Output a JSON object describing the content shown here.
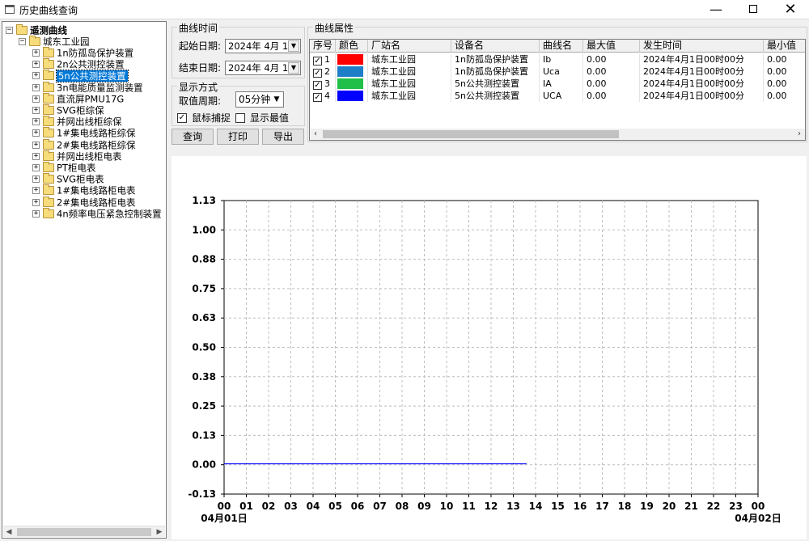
{
  "window": {
    "title": "历史曲线查询",
    "buttons": {
      "minimize": "—",
      "maximize": "",
      "close": "✕"
    }
  },
  "tree": {
    "root": "遥测曲线",
    "station": "城东工业园",
    "items": [
      "1n防孤岛保护装置",
      "2n公共测控装置",
      "5n公共测控装置",
      "3n电能质量监测装置",
      "直流屏PMU17G",
      "SVG柜综保",
      "并网出线柜综保",
      "1#集电线路柜综保",
      "2#集电线路柜综保",
      "并网出线柜电表",
      "PT柜电表",
      "SVG柜电表",
      "1#集电线路柜电表",
      "2#集电线路柜电表",
      "4n频率电压紧急控制装置"
    ],
    "selected_index": 2,
    "expand_symbols": {
      "expanded": "−",
      "collapsed": "+"
    }
  },
  "time_group": {
    "title": "曲线时间",
    "start_label": "起始日期:",
    "start_value": "2024年 4月 1",
    "end_label": "结束日期:",
    "end_value": "2024年 4月 1"
  },
  "display_group": {
    "title": "显示方式",
    "period_label": "取值周期:",
    "period_value": "05分钟",
    "mouse_capture_label": "鼠标捕捉",
    "mouse_capture_checked": true,
    "show_extremes_label": "显示最值",
    "show_extremes_checked": false
  },
  "actions": {
    "query": "查询",
    "print": "打印",
    "export": "导出"
  },
  "curve_props": {
    "title": "曲线属性",
    "columns": [
      "序号",
      "颜色",
      "厂站名",
      "设备名",
      "曲线名",
      "最大值",
      "发生时间",
      "最小值"
    ],
    "rows": [
      {
        "idx": "1",
        "checked": true,
        "color": "#ff0000",
        "station": "城东工业园",
        "device": "1n防孤岛保护装置",
        "curve": "Ib",
        "max": "0.00",
        "time": "2024年4月1日00时00分",
        "min": "0.00"
      },
      {
        "idx": "2",
        "checked": true,
        "color": "#1e7fc8",
        "station": "城东工业园",
        "device": "1n防孤岛保护装置",
        "curve": "Uca",
        "max": "0.00",
        "time": "2024年4月1日00时00分",
        "min": "0.00"
      },
      {
        "idx": "3",
        "checked": true,
        "color": "#1fbf4a",
        "station": "城东工业园",
        "device": "5n公共测控装置",
        "curve": "IA",
        "max": "0.00",
        "time": "2024年4月1日00时00分",
        "min": "0.00"
      },
      {
        "idx": "4",
        "checked": true,
        "color": "#0000ff",
        "station": "城东工业园",
        "device": "5n公共测控装置",
        "curve": "UCA",
        "max": "0.00",
        "time": "2024年4月1日00时00分",
        "min": "0.00"
      }
    ]
  },
  "chart_data": {
    "type": "line",
    "y_ticks": [
      "1.13",
      "1.00",
      "0.88",
      "0.75",
      "0.63",
      "0.50",
      "0.38",
      "0.25",
      "0.13",
      "0.00",
      "-0.13"
    ],
    "ylim": [
      -0.13,
      1.13
    ],
    "x_ticks": [
      "00",
      "01",
      "02",
      "03",
      "04",
      "05",
      "06",
      "07",
      "08",
      "09",
      "10",
      "11",
      "12",
      "13",
      "14",
      "15",
      "16",
      "17",
      "18",
      "19",
      "20",
      "21",
      "22",
      "23",
      "00"
    ],
    "xlim": [
      0,
      24
    ],
    "x_date_start": "04月01日",
    "x_date_end": "04月02日",
    "grid": true,
    "series": [
      {
        "color": "#0000ff",
        "x": [
          0,
          13.6
        ],
        "y": [
          0.0,
          0.0
        ]
      }
    ]
  }
}
